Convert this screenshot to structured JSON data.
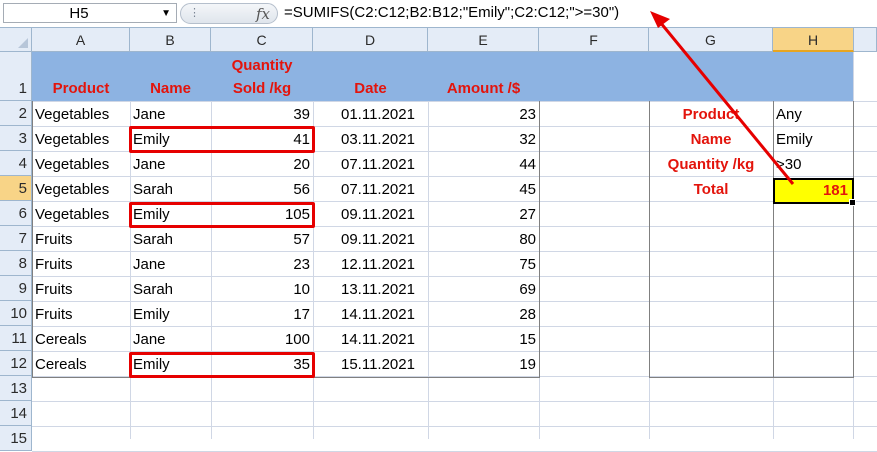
{
  "formula_bar": {
    "name_box": "H5",
    "fx_label": "fx",
    "formula": "=SUMIFS(C2:C12;B2:B12;\"Emily\";C2:C12;\">=30\")"
  },
  "columns": [
    "A",
    "B",
    "C",
    "D",
    "E",
    "F",
    "G",
    "H"
  ],
  "rows": [
    "1",
    "2",
    "3",
    "4",
    "5",
    "6",
    "7",
    "8",
    "9",
    "10",
    "11",
    "12",
    "13",
    "14",
    "15"
  ],
  "headers": {
    "product": "Product",
    "name": "Name",
    "quantity_line1": "Quantity",
    "quantity_line2": "Sold /kg",
    "date": "Date",
    "amount": "Amount /$"
  },
  "data_rows": [
    {
      "product": "Vegetables",
      "name": "Jane",
      "qty": "39",
      "date": "01.11.2021",
      "amount": "23"
    },
    {
      "product": "Vegetables",
      "name": "Emily",
      "qty": "41",
      "date": "03.11.2021",
      "amount": "32"
    },
    {
      "product": "Vegetables",
      "name": "Jane",
      "qty": "20",
      "date": "07.11.2021",
      "amount": "44"
    },
    {
      "product": "Vegetables",
      "name": "Sarah",
      "qty": "56",
      "date": "07.11.2021",
      "amount": "45"
    },
    {
      "product": "Vegetables",
      "name": "Emily",
      "qty": "105",
      "date": "09.11.2021",
      "amount": "27"
    },
    {
      "product": "Fruits",
      "name": "Sarah",
      "qty": "57",
      "date": "09.11.2021",
      "amount": "80"
    },
    {
      "product": "Fruits",
      "name": "Jane",
      "qty": "23",
      "date": "12.11.2021",
      "amount": "75"
    },
    {
      "product": "Fruits",
      "name": "Sarah",
      "qty": "10",
      "date": "13.11.2021",
      "amount": "69"
    },
    {
      "product": "Fruits",
      "name": "Emily",
      "qty": "17",
      "date": "14.11.2021",
      "amount": "28"
    },
    {
      "product": "Cereals",
      "name": "Jane",
      "qty": "100",
      "date": "14.11.2021",
      "amount": "15"
    },
    {
      "product": "Cereals",
      "name": "Emily",
      "qty": "35",
      "date": "15.11.2021",
      "amount": "19"
    }
  ],
  "criteria": {
    "product_label": "Product",
    "product_value": "Any",
    "name_label": "Name",
    "name_value": "Emily",
    "quantity_label": "Quantity /kg",
    "quantity_value": ">30",
    "total_label": "Total",
    "total_value": "181"
  },
  "colors": {
    "header_fill": "#8db3e2",
    "label_red": "#e3140c",
    "highlight_yellow": "#ffff00",
    "annotation_red": "#e60000"
  }
}
